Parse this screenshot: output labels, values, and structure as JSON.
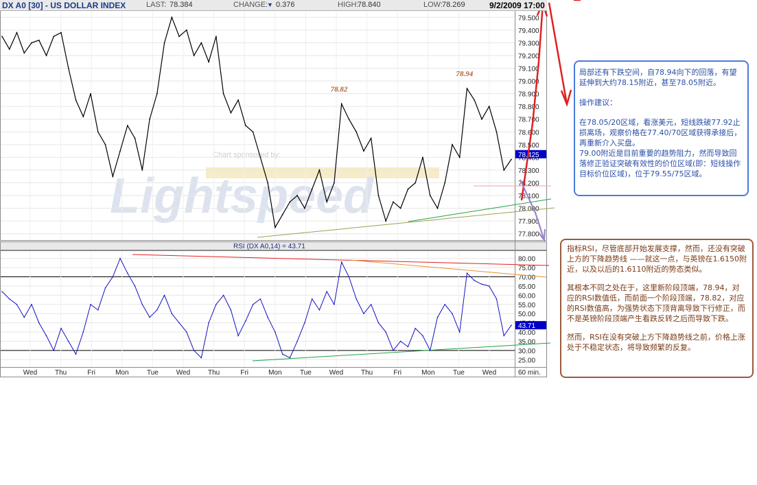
{
  "header": {
    "title": "DX A0 [30] - US DOLLAR INDEX",
    "last_label": "LAST:",
    "last_value": "78.384",
    "change_label": "CHANGE:",
    "change_value": "0.376",
    "high_label": "HIGH:",
    "high_value": "78.840",
    "low_label": "LOW:",
    "low_value": "78.269",
    "datetime": "9/2/2009 17:00"
  },
  "watermark": {
    "sponsor": "Chart sponsored by:",
    "logo": "Lightspeed"
  },
  "colors": {
    "price_line": "#000000",
    "rsi_line": "#1010c8",
    "red": "#e02020",
    "green": "#20a040",
    "olive": "#9aa050",
    "orange": "#e89030",
    "purple": "#9a86c8",
    "last_tag": "#0000c8"
  },
  "chart_data": [
    {
      "type": "line",
      "title": "DX A0 [30] - US DOLLAR INDEX",
      "y_ticks": [
        "79.500",
        "79.400",
        "79.300",
        "79.200",
        "79.100",
        "79.000",
        "78.900",
        "78.800",
        "78.700",
        "78.600",
        "78.500",
        "78.400",
        "78.300",
        "78.200",
        "78.100",
        "78.000",
        "77.900",
        "77.800"
      ],
      "ylim": [
        77.75,
        79.55
      ],
      "last_tag": "78.425",
      "annotations": [
        {
          "text": "78.82",
          "x_index": 46,
          "y": 78.82
        },
        {
          "text": "78.94",
          "x_index": 63,
          "y": 78.94
        }
      ],
      "series": [
        {
          "values": [
            79.35,
            79.25,
            79.38,
            79.22,
            79.3,
            79.32,
            79.2,
            79.35,
            79.38,
            79.1,
            78.85,
            78.72,
            78.9,
            78.6,
            78.5,
            78.25,
            78.45,
            78.65,
            78.55,
            78.3,
            78.7,
            78.9,
            79.3,
            79.5,
            79.35,
            79.4,
            79.2,
            79.3,
            79.15,
            79.35,
            78.9,
            78.75,
            78.85,
            78.65,
            78.6,
            78.4,
            78.2,
            77.85,
            77.95,
            78.05,
            78.1,
            78.0,
            78.15,
            78.3,
            78.05,
            78.2,
            78.82,
            78.7,
            78.6,
            78.45,
            78.55,
            78.1,
            77.9,
            78.05,
            78.0,
            78.15,
            78.2,
            78.4,
            78.1,
            78.0,
            78.2,
            78.5,
            78.4,
            78.94,
            78.85,
            78.7,
            78.8,
            78.6,
            78.3,
            78.384
          ]
        }
      ]
    },
    {
      "type": "line",
      "title": "RSI (DX A0,14) = 43.71",
      "y_ticks": [
        "80.00",
        "75.00",
        "70.00",
        "65.00",
        "60.00",
        "55.00",
        "50.00",
        "45.00",
        "40.00",
        "35.00",
        "30.00",
        "25.00"
      ],
      "ylim": [
        21,
        84
      ],
      "last_tag": "43.71",
      "reference_lines": [
        70,
        30
      ],
      "series": [
        {
          "values": [
            62,
            58,
            55,
            48,
            55,
            45,
            38,
            30,
            42,
            35,
            28,
            40,
            55,
            52,
            64,
            70,
            80,
            72,
            65,
            55,
            48,
            52,
            60,
            50,
            45,
            40,
            30,
            26,
            45,
            55,
            60,
            52,
            38,
            46,
            55,
            58,
            48,
            40,
            28,
            26,
            35,
            45,
            58,
            52,
            62,
            55,
            78,
            70,
            58,
            50,
            55,
            45,
            40,
            30,
            35,
            32,
            42,
            38,
            30,
            48,
            55,
            50,
            40,
            72,
            68,
            66,
            65,
            58,
            38,
            43.71
          ]
        }
      ],
      "x_ticks": [
        "Wed",
        "Thu",
        "Fri",
        "Mon",
        "Tue",
        "Wed",
        "Thu",
        "Fri",
        "Mon",
        "Tue",
        "Wed",
        "Thu",
        "Fri",
        "Mon",
        "Tue",
        "Wed"
      ],
      "interval": "60 min."
    }
  ],
  "notes": {
    "note1": {
      "p1": "局部还有下跌空间，自78.94向下的回落，有望延伸到大约78.15附近，甚至78.05附近。",
      "p2": "操作建议：",
      "p3": "在78.05/20区域，看涨美元，短线跌破77.92止损离场，观察价格在77.40/70区域获得承接后，再重新介入买盘。",
      "p4": "79.00附近是目前重要的趋势阻力，然而导致回落修正验证突破有效性的价位区域(即：短线操作目标价位区域)，位于79.55/75区域。"
    },
    "note2": {
      "p1": "指标RSI，尽管底部开始发展支撑，然而，还没有突破上方的下降趋势线 ——就这一点，与英镑在1.6150附近，以及以后的1.6110附近的势态类似。",
      "p2": "其根本不同之处在于，这里新阶段顶端，78.94，对应的RSI数值低，而前面一个阶段顶端，78.82，对应的RSI数值高，为强势状态下顶背离导致下行修正，而不是英镑阶段顶端产生看跌反转之后而导致下跌。",
      "p3": "然而，RSI在没有突破上方下降趋势线之前，价格上涨处于不稳定状态，将导致频繁的反复。"
    }
  }
}
